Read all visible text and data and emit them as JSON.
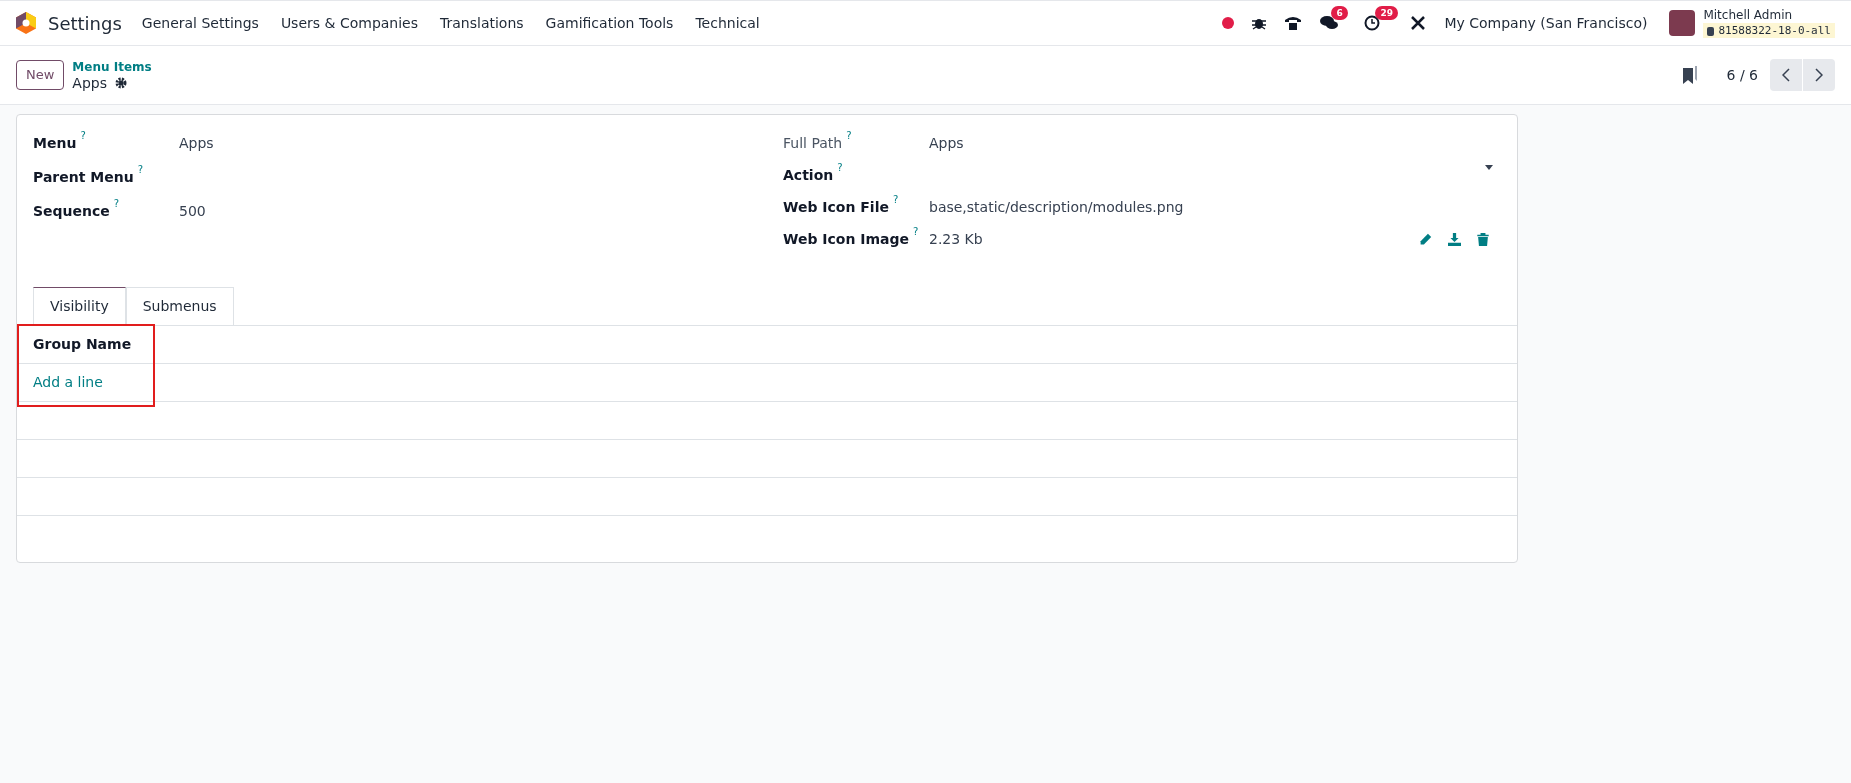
{
  "navbar": {
    "app_name": "Settings",
    "menus": [
      "General Settings",
      "Users & Companies",
      "Translations",
      "Gamification Tools",
      "Technical"
    ],
    "systray": {
      "recording": true,
      "messages_badge": "6",
      "activities_badge": "29",
      "company": "My Company (San Francisco)",
      "user_name": "Mitchell Admin",
      "database": "81588322-18-0-all"
    }
  },
  "control_panel": {
    "new_button": "New",
    "breadcrumb": "Menu Items",
    "record_title": "Apps",
    "pager": "6 / 6"
  },
  "form": {
    "left_fields": [
      {
        "label": "Menu",
        "help": "?",
        "value": "Apps",
        "readonly": false
      },
      {
        "label": "Parent Menu",
        "help": "?",
        "readonly": false
      },
      {
        "label": "Sequence",
        "help": "?",
        "value": "500",
        "readonly": false
      }
    ],
    "right_fields": [
      {
        "label": "Full Path",
        "help": "?",
        "value": "Apps",
        "kind": "text",
        "readonly": true
      },
      {
        "label": "Action",
        "help": "?",
        "kind": "select",
        "readonly": false
      },
      {
        "label": "Web Icon File",
        "help": "?",
        "value": "base,static/description/modules.png",
        "kind": "text",
        "readonly": false
      },
      {
        "label": "Web Icon Image",
        "help": "?",
        "value": "2.23 Kb",
        "kind": "binary",
        "readonly": false
      }
    ],
    "tabs": [
      {
        "label": "Visibility",
        "selected": true
      },
      {
        "label": "Submenus",
        "selected": false
      }
    ],
    "table": {
      "columns": [
        "Group Name"
      ],
      "add_line": "Add a line"
    }
  }
}
